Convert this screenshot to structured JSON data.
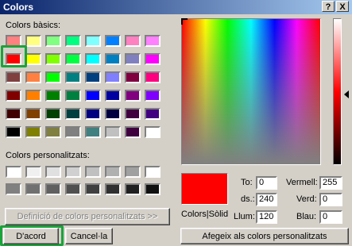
{
  "window": {
    "title": "Colors"
  },
  "titlebar_buttons": {
    "help": "?",
    "close": "X"
  },
  "basic_colors": {
    "label": "Colors bàsics:",
    "swatches": [
      "#ff8080",
      "#ffff80",
      "#80ff80",
      "#00ff80",
      "#80ffff",
      "#0080ff",
      "#ff80c0",
      "#ff80ff",
      "#ff0000",
      "#ffff00",
      "#80ff00",
      "#00ff40",
      "#00ffff",
      "#0080c0",
      "#8080c0",
      "#ff00ff",
      "#804040",
      "#ff8040",
      "#00ff00",
      "#008080",
      "#004080",
      "#8080ff",
      "#800040",
      "#ff0080",
      "#800000",
      "#ff8000",
      "#008000",
      "#008040",
      "#0000ff",
      "#0000a0",
      "#800080",
      "#8000ff",
      "#400000",
      "#804000",
      "#004000",
      "#004040",
      "#000080",
      "#000040",
      "#400040",
      "#400080",
      "#000000",
      "#808000",
      "#808040",
      "#808080",
      "#408080",
      "#c0c0c0",
      "#400040",
      "#ffffff"
    ]
  },
  "custom_colors": {
    "label": "Colors personalitzats:",
    "swatches": [
      "#ffffff",
      "#f0f0f0",
      "#e0e0e0",
      "#d0d0d0",
      "#c0c0c0",
      "#b0b0b0",
      "#a0a0a0",
      "#ffffff",
      "#808080",
      "#707070",
      "#606060",
      "#505050",
      "#404040",
      "#303030",
      "#202020",
      "#101010"
    ]
  },
  "buttons": {
    "define_custom": "Definició de colors personalitzats >>",
    "ok": "D'acord",
    "cancel": "Cancel·la",
    "add_custom": "Afegeix als colors personalitzats"
  },
  "preview": {
    "label": "Colors|Sòlid",
    "color": "#ff0000"
  },
  "hsl": {
    "hue_label": "To:",
    "hue": "0",
    "sat_label": "ds.:",
    "sat": "240",
    "lum_label": "Llum:",
    "lum": "120"
  },
  "rgb": {
    "red_label": "Vermell:",
    "red": "255",
    "green_label": "Verd:",
    "green": "0",
    "blue_label": "Blau:",
    "blue": "0"
  },
  "accent": {
    "focus": "#1aa33a",
    "titlebar": "#0a246a"
  }
}
